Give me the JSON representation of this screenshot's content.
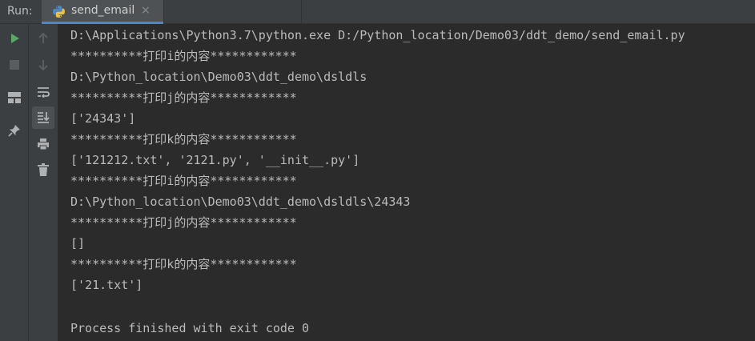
{
  "toolbar": {
    "run_label": "Run:",
    "tab_title": "send_email",
    "tab_close": "×"
  },
  "left_rail": {
    "icons": [
      "run-icon",
      "stop-icon",
      "layout-icon",
      "pin-icon"
    ]
  },
  "side_rail": {
    "icons": [
      "up-arrow-icon",
      "down-arrow-icon",
      "soft-wrap-icon",
      "scroll-to-end-icon",
      "print-icon",
      "trash-icon"
    ]
  },
  "console": {
    "lines": [
      "D:\\Applications\\Python3.7\\python.exe D:/Python_location/Demo03/ddt_demo/send_email.py",
      "**********打印i的内容************",
      "D:\\Python_location\\Demo03\\ddt_demo\\dsldls",
      "**********打印j的内容************",
      "['24343']",
      "**********打印k的内容************",
      "['121212.txt', '2121.py', '__init__.py']",
      "**********打印i的内容************",
      "D:\\Python_location\\Demo03\\ddt_demo\\dsldls\\24343",
      "**********打印j的内容************",
      "[]",
      "**********打印k的内容************",
      "['21.txt']",
      "",
      "Process finished with exit code 0"
    ]
  },
  "colors": {
    "run_green": "#59a869",
    "tab_underline": "#4a88c7",
    "text": "#bbbbbb",
    "background": "#2b2b2b"
  }
}
